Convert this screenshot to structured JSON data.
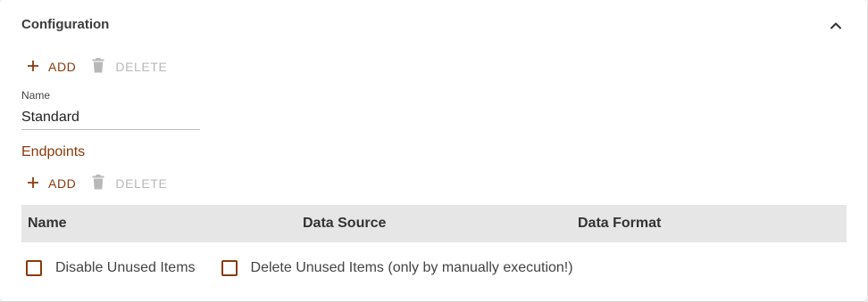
{
  "panel": {
    "title": "Configuration",
    "collapse_icon": "chevron-up-icon"
  },
  "toolbar_top": {
    "add_label": "ADD",
    "delete_label": "DELETE",
    "add_icon": "plus-icon",
    "delete_icon": "trash-icon",
    "delete_enabled": false
  },
  "name_field": {
    "label": "Name",
    "value": "Standard"
  },
  "endpoints": {
    "title": "Endpoints",
    "toolbar": {
      "add_label": "ADD",
      "delete_label": "DELETE",
      "add_icon": "plus-icon",
      "delete_icon": "trash-icon",
      "delete_enabled": false
    },
    "columns": [
      "Name",
      "Data Source",
      "Data Format"
    ],
    "rows": []
  },
  "options": {
    "disable_unused": {
      "label": "Disable Unused Items",
      "checked": false
    },
    "delete_unused": {
      "label": "Delete Unused Items (only by manually execution!)",
      "checked": false
    }
  },
  "colors": {
    "accent": "#8a3a0c",
    "disabled": "#b8b8b8",
    "table_header_bg": "#e6e6e6"
  }
}
